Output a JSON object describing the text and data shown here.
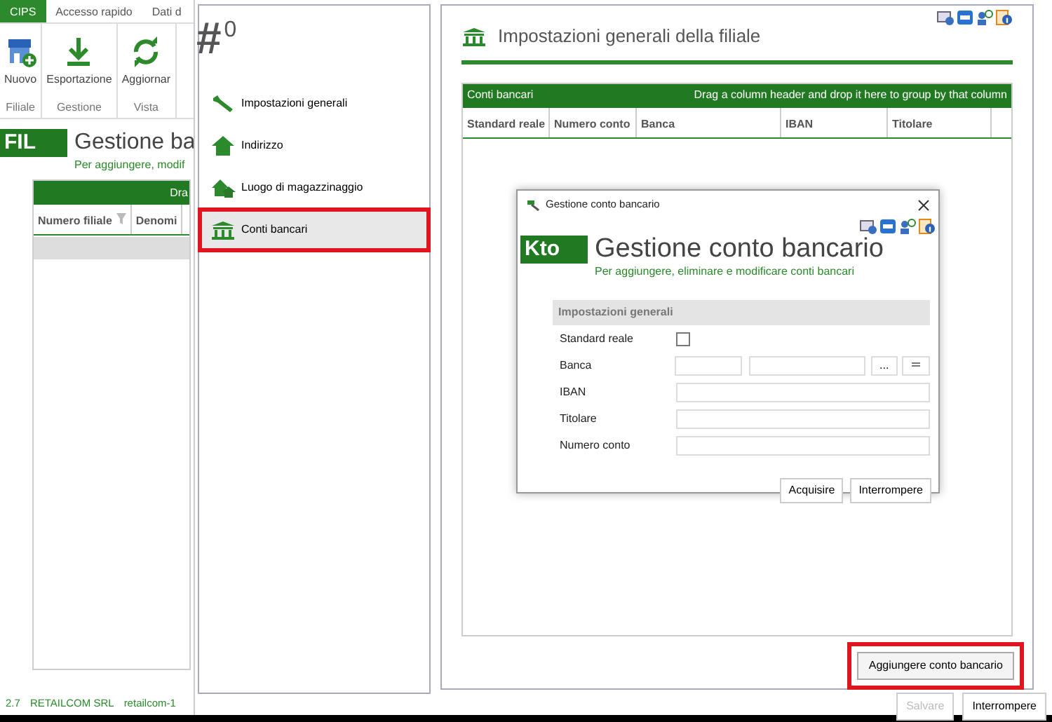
{
  "main_window": {
    "ribbon_tabs": [
      {
        "label": "CIPS",
        "selected": true
      },
      {
        "label": "Accesso rapido",
        "selected": false
      },
      {
        "label": "Dati d",
        "selected": false
      }
    ],
    "ribbon_groups": [
      {
        "label": "Filiale",
        "button": {
          "label": "Nuovo",
          "kind": "store"
        }
      },
      {
        "label": "Gestione",
        "button": {
          "label": "Esportazione",
          "kind": "download"
        }
      },
      {
        "label": "Vista",
        "button": {
          "label": "Aggiornar",
          "kind": "refresh"
        }
      }
    ],
    "badge": "FIL",
    "title": "Gestione ba",
    "subtitle": "Per aggiungere, modif",
    "grid": {
      "group_hint": "Dra",
      "columns": [
        {
          "label": "Numero filiale",
          "filter": true
        },
        {
          "label": "Denomi",
          "filter": false
        }
      ]
    },
    "status_bar": [
      "2.7",
      "RETAILCOM SRL",
      "retailcom-1"
    ]
  },
  "branch_window": {
    "number": {
      "symbol": "#",
      "value": "0"
    },
    "nav": [
      {
        "label": "Impostazioni generali",
        "kind": "wrench",
        "selected": false,
        "highlighted": false
      },
      {
        "label": "Indirizzo",
        "kind": "house",
        "selected": false,
        "highlighted": false
      },
      {
        "label": "Luogo di magazzinaggio",
        "kind": "houses",
        "selected": false,
        "highlighted": false
      },
      {
        "label": "Conti bancari",
        "kind": "bank",
        "selected": true,
        "highlighted": true
      }
    ],
    "section": {
      "title": "Impostazioni generali della filiale",
      "grid": {
        "title": "Conti bancari",
        "group_hint": "Drag a column header and drop it here to group by that column",
        "columns": [
          "Standard reale",
          "Numero conto",
          "Banca",
          "IBAN",
          "Titolare"
        ]
      },
      "add_button": {
        "label": "Aggiungere conto bancario",
        "highlighted": true
      }
    },
    "footer_buttons": [
      {
        "label": "Salvare",
        "disabled": true
      },
      {
        "label": "Interrompere",
        "disabled": false
      }
    ]
  },
  "dialog": {
    "title": "Gestione conto bancario",
    "badge": "Kto",
    "heading": "Gestione conto bancario",
    "subtitle": "Per aggiungere, eliminare e modificare conti bancari",
    "group": "Impostazioni generali",
    "fields": [
      {
        "label": "Standard reale",
        "kind": "checkbox",
        "checked": false
      },
      {
        "label": "Banca",
        "kind": "lookup",
        "browse_label": "..."
      },
      {
        "label": "IBAN",
        "kind": "text"
      },
      {
        "label": "Titolare",
        "kind": "text"
      },
      {
        "label": "Numero conto",
        "kind": "text"
      }
    ],
    "buttons": [
      "Acquisire",
      "Interrompere"
    ]
  }
}
